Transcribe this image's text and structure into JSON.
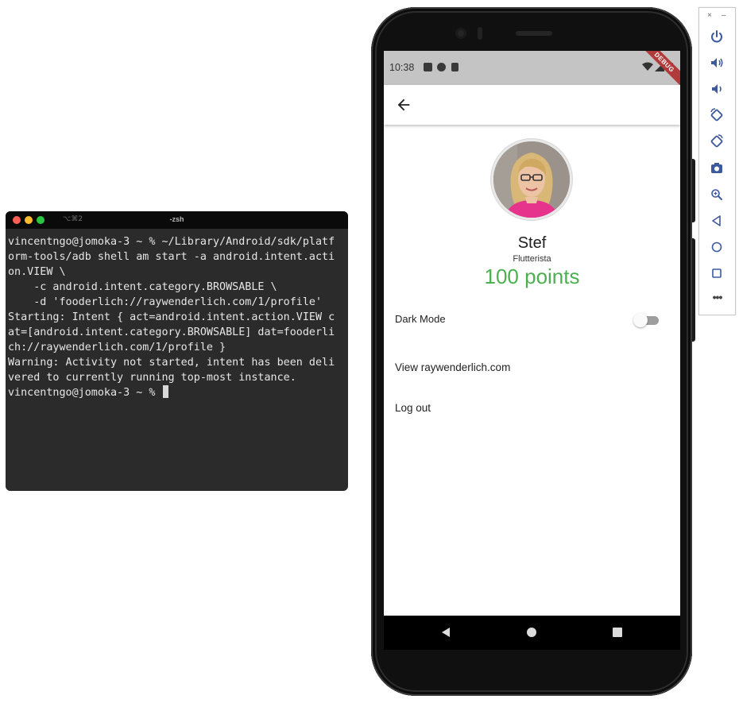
{
  "terminal": {
    "shortcut": "⌥⌘2",
    "title": "-zsh",
    "lines": [
      "vincentngo@jomoka-3 ~ % ~/Library/Android/sdk/platf",
      "orm-tools/adb shell am start -a android.intent.acti",
      "on.VIEW \\",
      "    -c android.intent.category.BROWSABLE \\",
      "    -d 'fooderlich://raywenderlich.com/1/profile'",
      "Starting: Intent { act=android.intent.action.VIEW c",
      "at=[android.intent.category.BROWSABLE] dat=fooderli",
      "ch://raywenderlich.com/1/profile }",
      "Warning: Activity not started, intent has been deli",
      "vered to currently running top-most instance."
    ],
    "prompt": "vincentngo@jomoka-3 ~ % "
  },
  "phone": {
    "status_bar": {
      "time": "10:38",
      "debug_banner": "DEBUG"
    },
    "profile": {
      "name": "Stef",
      "role": "Flutterista",
      "points": "100 points"
    },
    "settings": {
      "dark_mode_label": "Dark Mode",
      "dark_mode_enabled": false,
      "view_site_label": "View raywenderlich.com",
      "logout_label": "Log out"
    },
    "colors": {
      "points": "#4caf50",
      "status_bar": "#c4c4c4",
      "debug_banner": "#b13b3b"
    }
  },
  "emulator_toolbar": {
    "close": "×",
    "minimize": "–",
    "more": "•••",
    "buttons": [
      "power-icon",
      "volume-up-icon",
      "volume-down-icon",
      "rotate-left-icon",
      "rotate-right-icon",
      "camera-icon",
      "zoom-icon",
      "back-icon",
      "home-icon",
      "overview-icon"
    ]
  }
}
